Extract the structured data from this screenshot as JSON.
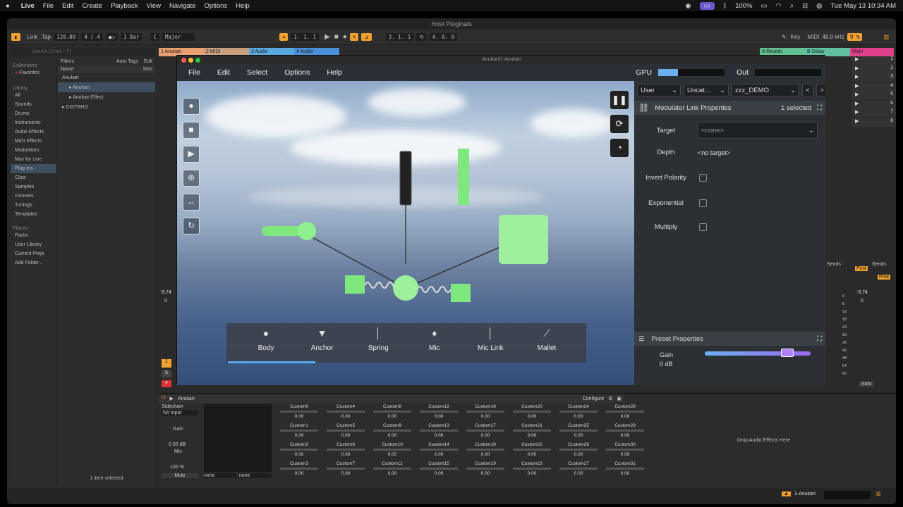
{
  "macbar": {
    "menus": [
      "Live",
      "File",
      "Edit",
      "Create",
      "Playback",
      "View",
      "Navigate",
      "Options",
      "Help"
    ],
    "battery": "100%",
    "datetime": "Tue May 13  10:34 AM"
  },
  "window": {
    "title": "Host Pluginals"
  },
  "transport": {
    "link": "Link",
    "tap": "Tap",
    "tempo": "120.00",
    "signature": "4 / 4",
    "quantize": "1 Bar",
    "key": "C",
    "scale": "Major",
    "position": "1.  1.  1",
    "loop_start": "3.  1.  1",
    "loop_length": "4.  0.  0",
    "key_label": "Key",
    "midi_label": "MIDI",
    "sample_rate": "48.0 kHz",
    "cpu": "9 %"
  },
  "browser": {
    "search_placeholder": "Search (Cmd + F)",
    "filters_label": "Filters",
    "auto_tags_label": "Auto Tags",
    "edit_label": "Edit",
    "collections_title": "Collections",
    "favorites": "Favorites",
    "library_title": "Library",
    "library_items": [
      "All",
      "Sounds",
      "Drums",
      "Instruments",
      "Audio Effects",
      "MIDI Effects",
      "Modulators",
      "Max for Live",
      "Plug-Ins",
      "Clips",
      "Samples",
      "Grooves",
      "Tunings",
      "Templates"
    ],
    "places_title": "Places",
    "places_items": [
      "Packs",
      "User Library",
      "Current Proje",
      "Add Folder..."
    ],
    "col_name": "Name",
    "col_size": "Size",
    "tree": [
      "Anukari",
      "Anukari",
      "Anukari Effect",
      "DISTRHO"
    ],
    "status": "1 item selected"
  },
  "tracks": [
    {
      "label": "1 Anukari",
      "color": "#e8a070"
    },
    {
      "label": "2 MIDI",
      "color": "#c8a080"
    },
    {
      "label": "3 Audio",
      "color": "#5aa8e0"
    },
    {
      "label": "4 Audio",
      "color": "#4a90d8"
    },
    {
      "label": "A Reverb",
      "color": "#60c090"
    },
    {
      "label": "B Delay",
      "color": "#60c0a0"
    },
    {
      "label": "Main",
      "color": "#e0408a"
    }
  ],
  "plugin": {
    "title": "Anukari/1-Anukari",
    "menu": [
      "File",
      "Edit",
      "Select",
      "Options",
      "Help"
    ],
    "gpu_label": "GPU",
    "out_label": "Out",
    "preset_user": "User",
    "preset_category": "Uncat...",
    "preset_name": "zzz_DEMO",
    "prev": "<",
    "next": ">",
    "mlp_title": "Modulator Link Properties",
    "mlp_selected": "1 selected",
    "target_label": "Target",
    "target_value": "<none>",
    "depth_label": "Depth",
    "depth_value": "<no target>",
    "invert_label": "Invert Polarity",
    "exponential_label": "Exponential",
    "multiply_label": "Multiply",
    "preset_props_title": "Preset Properties",
    "gain_label": "Gain",
    "gain_value": "0 dB",
    "objects": [
      "Body",
      "Anchor",
      "Spring",
      "Mic",
      "Mic Link",
      "Mallet"
    ]
  },
  "device": {
    "name": "Anukari",
    "configure": "Configure",
    "sidechain_label": "Sidechain",
    "sidechain_value": "No Input",
    "gain_label": "Gain",
    "gain_value": "0.00 dB",
    "mix_label": "Mix",
    "mix_value": "100 %",
    "mute_label": "Mute",
    "none1": "none",
    "none2": "none",
    "params": [
      {
        "name": "Custom0",
        "v": "0.00"
      },
      {
        "name": "Custom4",
        "v": "0.00"
      },
      {
        "name": "Custom8",
        "v": "0.00"
      },
      {
        "name": "Custom12",
        "v": "0.00"
      },
      {
        "name": "Custom16",
        "v": "0.00"
      },
      {
        "name": "Custom20",
        "v": "0.00"
      },
      {
        "name": "Custom24",
        "v": "0.00"
      },
      {
        "name": "Custom28",
        "v": "0.00"
      },
      {
        "name": "Custom1",
        "v": "0.00"
      },
      {
        "name": "Custom5",
        "v": "0.00"
      },
      {
        "name": "Custom9",
        "v": "0.00"
      },
      {
        "name": "Custom13",
        "v": "0.00"
      },
      {
        "name": "Custom17",
        "v": "0.00"
      },
      {
        "name": "Custom21",
        "v": "0.00"
      },
      {
        "name": "Custom25",
        "v": "0.00"
      },
      {
        "name": "Custom29",
        "v": "0.00"
      },
      {
        "name": "Custom2",
        "v": "0.00"
      },
      {
        "name": "Custom6",
        "v": "0.00"
      },
      {
        "name": "Custom10",
        "v": "0.00"
      },
      {
        "name": "Custom14",
        "v": "0.00"
      },
      {
        "name": "Custom18",
        "v": "0.00"
      },
      {
        "name": "Custom22",
        "v": "0.00"
      },
      {
        "name": "Custom26",
        "v": "0.00"
      },
      {
        "name": "Custom30",
        "v": "0.00"
      },
      {
        "name": "Custom3",
        "v": "0.00"
      },
      {
        "name": "Custom7",
        "v": "0.00"
      },
      {
        "name": "Custom11",
        "v": "0.00"
      },
      {
        "name": "Custom15",
        "v": "0.00"
      },
      {
        "name": "Custom19",
        "v": "0.00"
      },
      {
        "name": "Custom23",
        "v": "0.00"
      },
      {
        "name": "Custom27",
        "v": "0.00"
      },
      {
        "name": "Custom31",
        "v": "0.00"
      }
    ],
    "drop_hint": "Drop Audio Effects Here"
  },
  "mixer": {
    "volume_left": "-9.74",
    "zero_left": "0",
    "volume_right": "-9.74",
    "zero_right": "0",
    "sends_label": "Sends",
    "post_label": "Post",
    "solo_label": "Solo",
    "track_number": "1",
    "s_label": "S",
    "scene_numbers": [
      "1",
      "2",
      "3",
      "4",
      "5",
      "6",
      "7",
      "8"
    ],
    "db_scale": [
      "0",
      "6",
      "12",
      "18",
      "24",
      "30",
      "36",
      "42",
      "48",
      "54",
      "60"
    ]
  },
  "statusbar": {
    "track": "1-Anukari"
  }
}
